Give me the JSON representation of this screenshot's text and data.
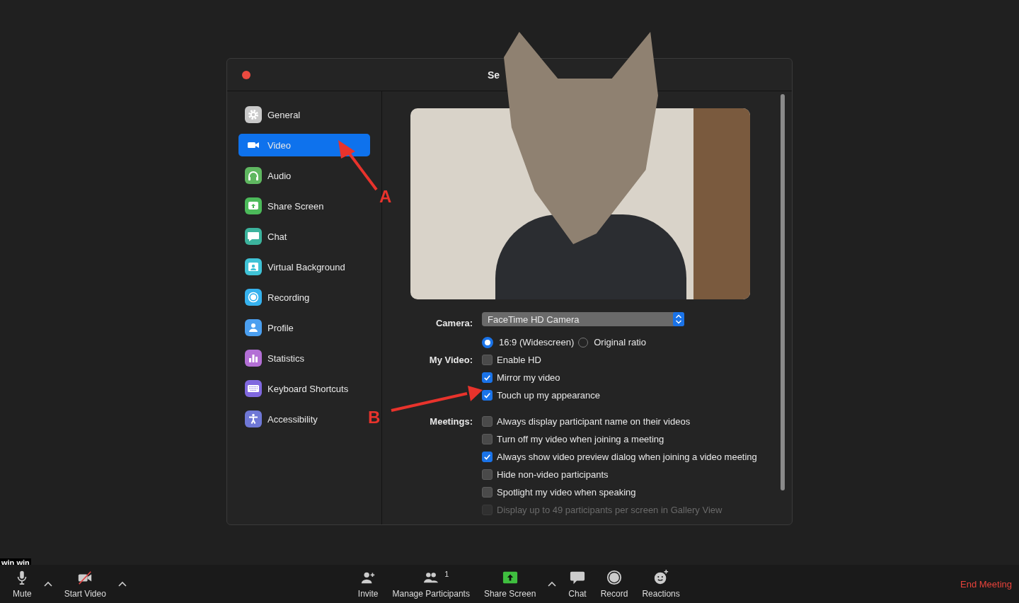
{
  "window": {
    "title": "Se"
  },
  "sidebar": {
    "items": [
      {
        "label": "General",
        "kind": "gear",
        "color": "#c9c9c9",
        "selected": false
      },
      {
        "label": "Video",
        "kind": "camera",
        "selected": true
      },
      {
        "label": "Audio",
        "kind": "headphones",
        "color": "#5fb760",
        "selected": false
      },
      {
        "label": "Share Screen",
        "kind": "share",
        "color": "#4cba5a",
        "selected": false
      },
      {
        "label": "Chat",
        "kind": "chat",
        "color": "#3cb39d",
        "selected": false
      },
      {
        "label": "Virtual Background",
        "kind": "portrait",
        "color": "#3fc2d6",
        "selected": false
      },
      {
        "label": "Recording",
        "kind": "record",
        "color": "#36b2ee",
        "selected": false
      },
      {
        "label": "Profile",
        "kind": "person",
        "color": "#4b9ff0",
        "selected": false
      },
      {
        "label": "Statistics",
        "kind": "stats",
        "color": "#b36fd5",
        "selected": false
      },
      {
        "label": "Keyboard Shortcuts",
        "kind": "keyboard",
        "color": "#8068df",
        "selected": false
      },
      {
        "label": "Accessibility",
        "kind": "accessibility",
        "color": "#6f78d6",
        "selected": false
      }
    ]
  },
  "camera": {
    "label": "Camera:",
    "value": "FaceTime HD Camera"
  },
  "aspect_ratio": [
    {
      "label": "16:9 (Widescreen)",
      "selected": true
    },
    {
      "label": "Original ratio",
      "selected": false
    }
  ],
  "my_video": {
    "label": "My Video:",
    "options": [
      {
        "label": "Enable HD",
        "checked": false,
        "disabled": false
      },
      {
        "label": "Mirror my video",
        "checked": true,
        "disabled": false
      },
      {
        "label": "Touch up my appearance",
        "checked": true,
        "disabled": false
      }
    ]
  },
  "meetings": {
    "label": "Meetings:",
    "options": [
      {
        "label": "Always display participant name on their videos",
        "checked": false,
        "disabled": false
      },
      {
        "label": "Turn off my video when joining a meeting",
        "checked": false,
        "disabled": false
      },
      {
        "label": "Always show video preview dialog when joining a video meeting",
        "checked": true,
        "disabled": false
      },
      {
        "label": "Hide non-video participants",
        "checked": false,
        "disabled": false
      },
      {
        "label": "Spotlight my video when speaking",
        "checked": false,
        "disabled": false
      },
      {
        "label": "Display up to 49 participants per screen in Gallery View",
        "checked": false,
        "disabled": true
      }
    ]
  },
  "annotations": [
    {
      "label": "A"
    },
    {
      "label": "B"
    }
  ],
  "name_tag": "win win",
  "toolbar": {
    "left": [
      {
        "label": "Mute",
        "kind": "mic",
        "caret": true
      },
      {
        "label": "Start Video",
        "kind": "video-off",
        "caret": true
      }
    ],
    "center": [
      {
        "label": "Invite",
        "kind": "invite",
        "caret": false
      },
      {
        "label": "Manage Participants",
        "kind": "participants",
        "badge": "1",
        "caret": false
      },
      {
        "label": "Share Screen",
        "kind": "share",
        "caret": true
      },
      {
        "label": "Chat",
        "kind": "chat",
        "caret": false
      },
      {
        "label": "Record",
        "kind": "record",
        "caret": false
      },
      {
        "label": "Reactions",
        "kind": "reactions",
        "caret": false
      }
    ],
    "end_meeting": "End Meeting"
  }
}
